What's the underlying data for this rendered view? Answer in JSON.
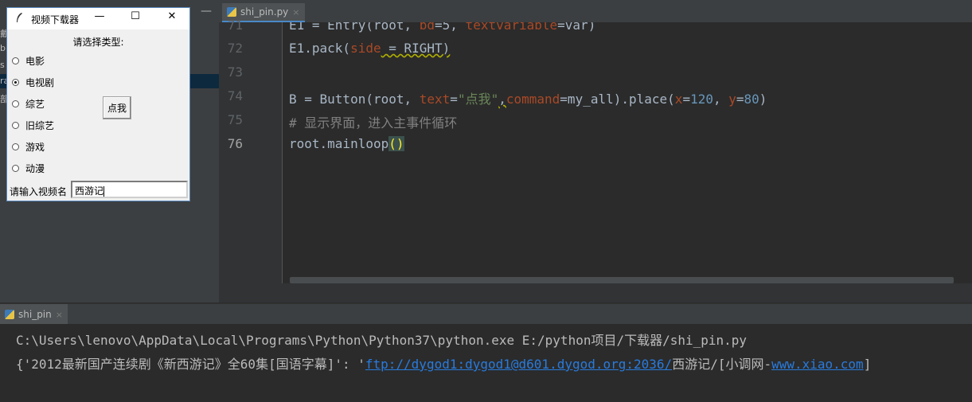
{
  "project_panel": {
    "fragments": [
      "戴",
      "b",
      "s",
      "ra",
      "部"
    ],
    "collapse_symbol": "—"
  },
  "editor": {
    "tab": {
      "filename": "shi_pin.py",
      "close": "×"
    },
    "lines": [
      {
        "num": "71"
      },
      {
        "num": "72"
      },
      {
        "num": "73"
      },
      {
        "num": "74"
      },
      {
        "num": "75"
      },
      {
        "num": "76"
      }
    ],
    "code": {
      "l71": {
        "a": "E1 = Entry(root, ",
        "b": "bd",
        "c": "=5, ",
        "d": "textvariable",
        "e": "=var)"
      },
      "l72": {
        "a": "E1.pack(",
        "b": "side",
        "c": " = RIGHT)"
      },
      "l74": {
        "a": "B = Button(root, ",
        "b": "text",
        "c": "=",
        "d": "\"点我\"",
        "e": ",",
        "f": "command",
        "g": "=my_all).place(",
        "h": "x",
        "i": "=",
        "j": "120",
        "k": ", ",
        "l": "y",
        "m": "=",
        "n": "80",
        "o": ")"
      },
      "l75": {
        "a": "# 显示界面，进入主事件循环"
      },
      "l76": {
        "a": "root.mainloop",
        "b": "()"
      }
    }
  },
  "run_panel": {
    "tab": {
      "name": "shi_pin",
      "close": "×"
    },
    "line1": "C:\\Users\\lenovo\\AppData\\Local\\Programs\\Python\\Python37\\python.exe E:/python项目/下载器/shi_pin.py",
    "line2": {
      "prefix": "{'2012最新国产连续剧《新西游记》全60集[国语字幕]': '",
      "link1": "ftp://dygod1:dygod1@d601.dygod.org:2036/",
      "middle": "西游记/[小调网-",
      "link2": "www.xiao.com",
      "suffix": "]"
    }
  },
  "tk_window": {
    "title": "视频下载器",
    "controls": {
      "minimize": "—",
      "maximize": "☐",
      "close": "✕"
    },
    "header": "请选择类型:",
    "options": [
      {
        "label": "电影",
        "selected": false
      },
      {
        "label": "电视剧",
        "selected": true
      },
      {
        "label": "综艺",
        "selected": false
      },
      {
        "label": "旧综艺",
        "selected": false
      },
      {
        "label": "游戏",
        "selected": false
      },
      {
        "label": "动漫",
        "selected": false
      }
    ],
    "button_label": "点我",
    "input_label": "请输入视频名",
    "input_value": "西游记"
  }
}
